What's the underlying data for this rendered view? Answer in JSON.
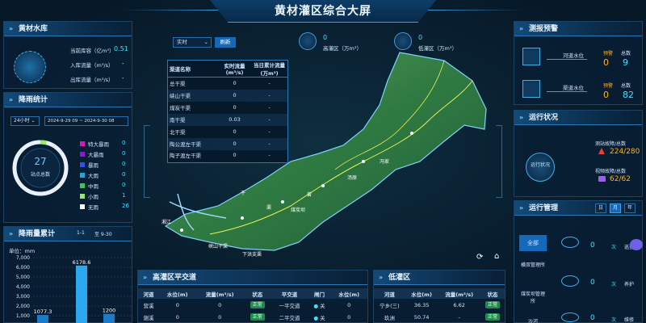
{
  "header": {
    "title": "黄材灌区综合大屏"
  },
  "top_controls": {
    "mode": "实时",
    "button": "刷新"
  },
  "stats": {
    "high_value": "0",
    "high_label": "高灌区（万m³）",
    "low_value": "0",
    "low_label": "低灌区（万m³）"
  },
  "reservoir": {
    "title": "黄材水库",
    "rows": [
      {
        "label": "当前库容（亿m³）",
        "value": "0.51"
      },
      {
        "label": "入库流量（m³/s）",
        "value": "-"
      },
      {
        "label": "出库流量（m³/s）",
        "value": "-"
      }
    ]
  },
  "rainfall": {
    "title": "降雨统计",
    "range_select": "24小时",
    "date_range": "2024-9-29 09  ~  2024-9-30 08",
    "total": "27",
    "total_label": "站点总数",
    "legend": [
      {
        "label": "特大暴雨",
        "value": "0",
        "color": "#d61ab8"
      },
      {
        "label": "大暴雨",
        "value": "0",
        "color": "#8a1ad6"
      },
      {
        "label": "暴雨",
        "value": "0",
        "color": "#3050e8"
      },
      {
        "label": "大雨",
        "value": "0",
        "color": "#1aa8e8"
      },
      {
        "label": "中雨",
        "value": "0",
        "color": "#38c858"
      },
      {
        "label": "小雨",
        "value": "1",
        "color": "#9ae870"
      },
      {
        "label": "无雨",
        "value": "26",
        "color": "#ffffff"
      }
    ]
  },
  "rain_accum": {
    "title": "降雨量累计",
    "d1": "1-1",
    "d2": "至  9-30",
    "unit": "单位：mm",
    "yticks": [
      "7,000",
      "6,000",
      "5,000",
      "4,000",
      "3,000",
      "2,000",
      "1,000",
      "0"
    ]
  },
  "chart_data": {
    "type": "bar",
    "values": [
      1077.3,
      6178.6,
      1200
    ],
    "ylim": [
      0,
      7000
    ],
    "ylabel": "单位：mm"
  },
  "canal_table": {
    "headers": [
      "渠道名称",
      "实时流量(m³/s)",
      "当日累计流量(万m³)"
    ],
    "rows": [
      [
        "总干渠",
        "0",
        "-"
      ],
      [
        "峡山干渠",
        "0",
        "-"
      ],
      [
        "煤炭干渠",
        "0",
        "-"
      ],
      [
        "南干渠",
        "0.03",
        "-"
      ],
      [
        "北干渠",
        "0",
        "-"
      ],
      [
        "陶公渡左干渠",
        "0",
        "-"
      ],
      [
        "陶子渡左干渠",
        "0",
        "-"
      ]
    ]
  },
  "monitor": {
    "title": "测报预警",
    "items": [
      {
        "label": "河道水位",
        "warn_label": "预警",
        "warn": "0",
        "total_label": "总数",
        "total": "9"
      },
      {
        "label": "渠道水位",
        "warn_label": "预警",
        "warn": "0",
        "total_label": "总数",
        "total": "82"
      }
    ]
  },
  "operation": {
    "title": "运行状况",
    "center": "运行状况",
    "items": [
      {
        "label": "测站故障/总数",
        "value": "224/280"
      },
      {
        "label": "视频故障/总数",
        "value": "62/62"
      }
    ]
  },
  "management": {
    "title": "运行管理",
    "tabs": [
      "日",
      "月",
      "年"
    ],
    "side": [
      "全部",
      "横双管理所",
      "煤炭坝管理所",
      "沙河"
    ],
    "items": [
      {
        "value": "0",
        "unit": "次",
        "label": "巡查"
      },
      {
        "value": "0",
        "unit": "次",
        "label": "养护"
      },
      {
        "value": "0",
        "unit": "次",
        "label": "维修"
      }
    ]
  },
  "high_traffic": {
    "title": "高灌区平交道",
    "headers": [
      "河道",
      "水位(m)",
      "流量(m³/s)",
      "状态",
      "平交道",
      "闸门",
      "水位(m)"
    ],
    "rows": [
      [
        "营溪",
        "0",
        "0",
        "正常",
        "一平交道",
        "关",
        "0"
      ],
      [
        "谢溪",
        "0",
        "0",
        "正常",
        "二平交道",
        "关",
        "0"
      ]
    ]
  },
  "low_area": {
    "title": "低灌区",
    "headers": [
      "河道",
      "水位(m)",
      "流量(m³/s)",
      "状态"
    ],
    "rows": [
      [
        "宁乡(三)",
        "36.35",
        "6.62",
        "正常"
      ],
      [
        "玖洲",
        "50.74",
        "-",
        "正常"
      ]
    ]
  },
  "map_labels": [
    "峡山干渠",
    "下洪支渠",
    "煤炭坝",
    "汤原",
    "干",
    "渠",
    "曾",
    "冯家",
    "湘江"
  ]
}
